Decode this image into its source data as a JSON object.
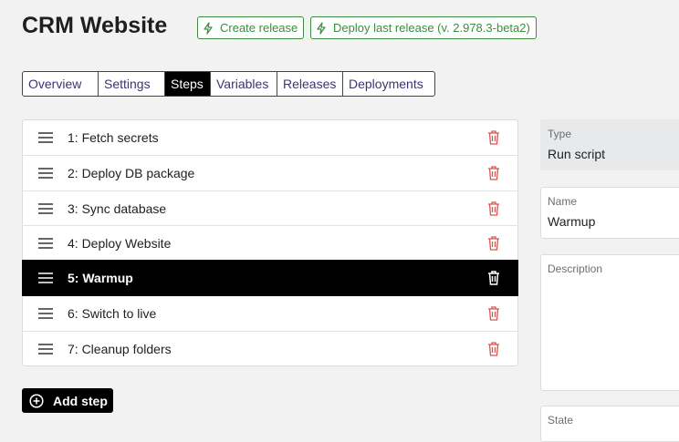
{
  "page": {
    "title": "CRM Website"
  },
  "header": {
    "create_release": "Create release",
    "deploy_last": "Deploy last release (v. 2.978.3-beta2)"
  },
  "tabs": [
    {
      "label": "Overview"
    },
    {
      "label": "Settings"
    },
    {
      "label": "Steps",
      "active": true
    },
    {
      "label": "Variables"
    },
    {
      "label": "Releases"
    },
    {
      "label": "Deployments"
    }
  ],
  "steps": [
    {
      "label": "1: Fetch secrets"
    },
    {
      "label": "2: Deploy DB package"
    },
    {
      "label": "3: Sync database"
    },
    {
      "label": "4: Deploy Website"
    },
    {
      "label": "5: Warmup",
      "selected": true
    },
    {
      "label": "6: Switch to live"
    },
    {
      "label": "7: Cleanup folders"
    }
  ],
  "add_step": "Add step",
  "details": {
    "type_label": "Type",
    "type_value": "Run script",
    "name_label": "Name",
    "name_value": "Warmup",
    "description_label": "Description",
    "state_label": "State"
  },
  "colors": {
    "accent_green": "#3d8b40",
    "trash_red": "#d9534f",
    "selected_bg": "#000000"
  }
}
